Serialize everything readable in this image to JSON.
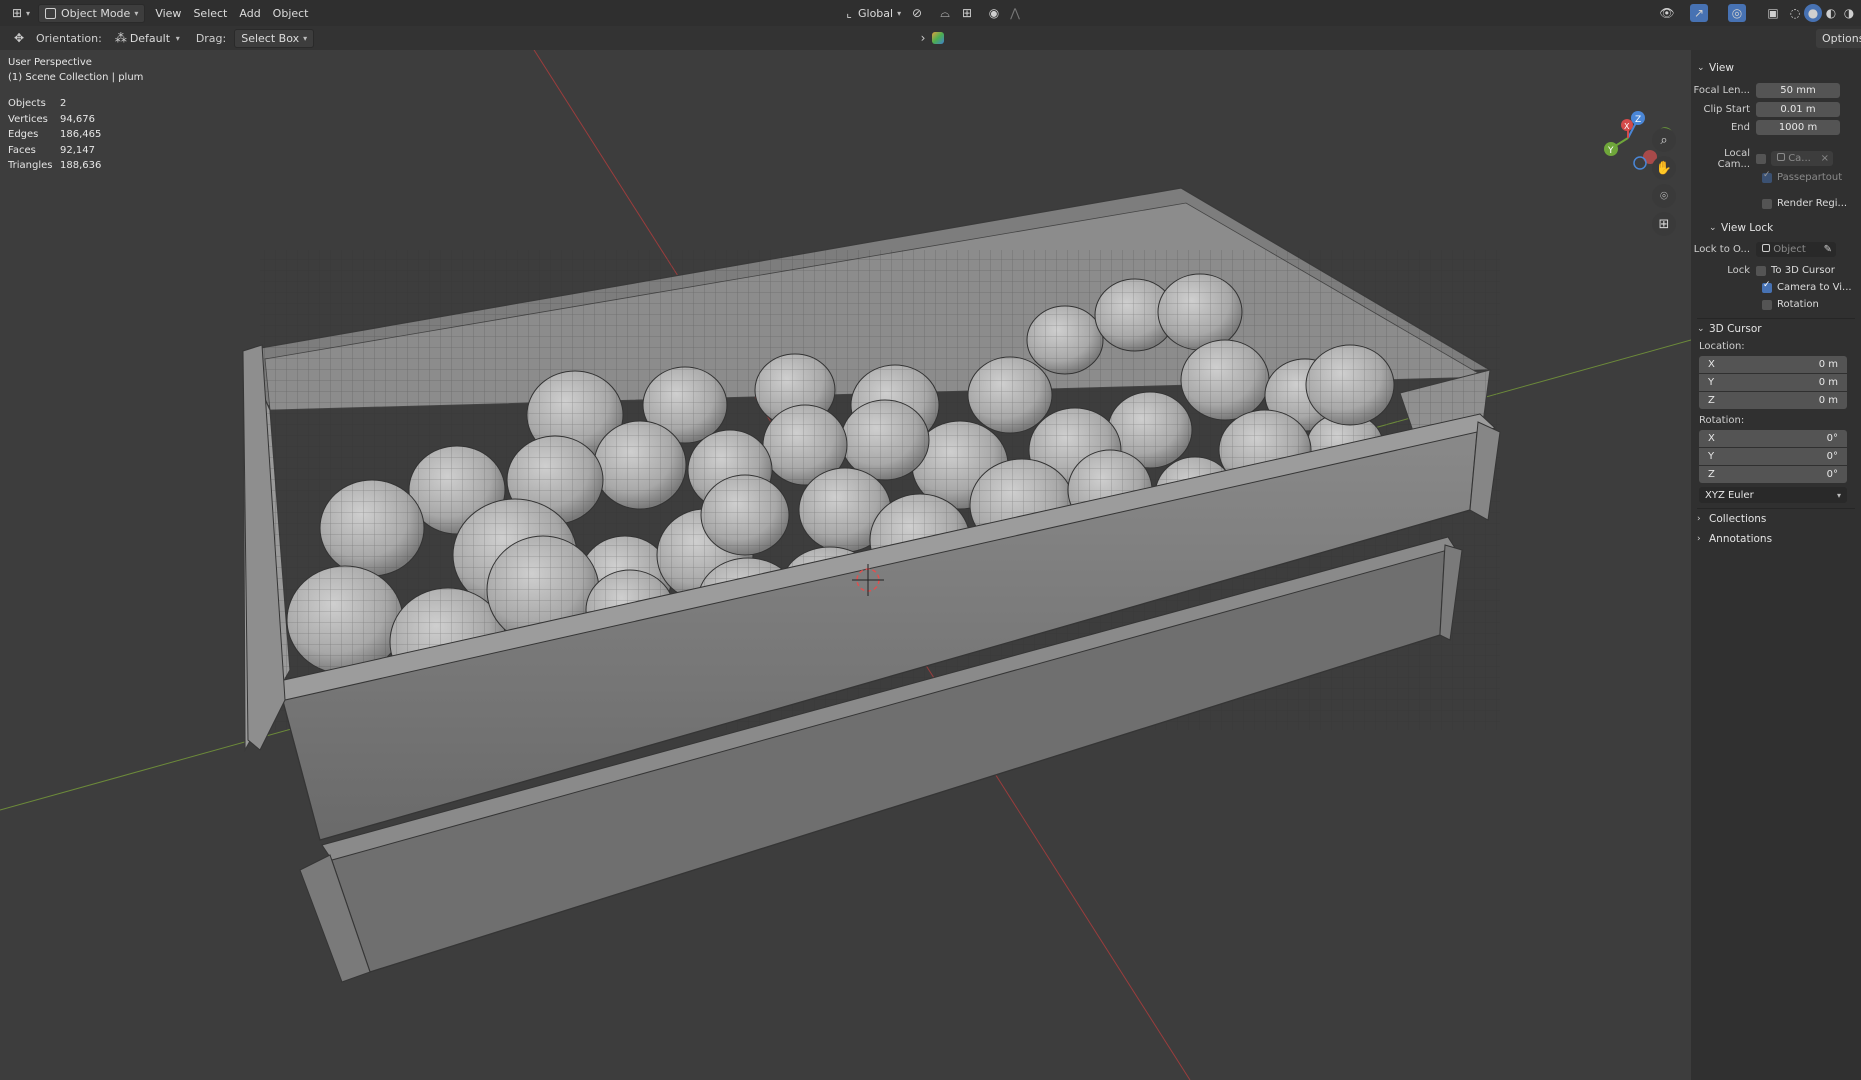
{
  "header": {
    "mode": "Object Mode",
    "menus": [
      "View",
      "Select",
      "Add",
      "Object"
    ],
    "transform_orientation": "Global"
  },
  "toolbar": {
    "orientation_label": "Orientation:",
    "orientation_value": "Default",
    "drag_label": "Drag:",
    "drag_value": "Select Box",
    "options_label": "Options"
  },
  "viewport": {
    "perspective": "User Perspective",
    "collection": "(1) Scene Collection | plum",
    "stats": [
      {
        "label": "Objects",
        "value": "2"
      },
      {
        "label": "Vertices",
        "value": "94,676"
      },
      {
        "label": "Edges",
        "value": "186,465"
      },
      {
        "label": "Faces",
        "value": "92,147"
      },
      {
        "label": "Triangles",
        "value": "188,636"
      }
    ],
    "gizmo": {
      "x": "X",
      "y": "Y",
      "z": "Z"
    }
  },
  "sidebar": {
    "view": {
      "title": "View",
      "focal_length_label": "Focal Len...",
      "focal_length": "50 mm",
      "clip_start_label": "Clip Start",
      "clip_start": "0.01 m",
      "clip_end_label": "End",
      "clip_end": "1000 m",
      "local_camera_label": "Local Cam...",
      "local_camera_value": "Ca...",
      "passepartout": "Passepartout",
      "render_region": "Render Regi..."
    },
    "view_lock": {
      "title": "View Lock",
      "lock_to_object_label": "Lock to O...",
      "lock_to_object_placeholder": "Object",
      "lock_label": "Lock",
      "to_3d_cursor": "To 3D Cursor",
      "camera_to_view": "Camera to Vi...",
      "rotation": "Rotation"
    },
    "cursor": {
      "title": "3D Cursor",
      "location_label": "Location:",
      "location": [
        {
          "axis": "X",
          "value": "0 m"
        },
        {
          "axis": "Y",
          "value": "0 m"
        },
        {
          "axis": "Z",
          "value": "0 m"
        }
      ],
      "rotation_label": "Rotation:",
      "rotation": [
        {
          "axis": "X",
          "value": "0°"
        },
        {
          "axis": "Y",
          "value": "0°"
        },
        {
          "axis": "Z",
          "value": "0°"
        }
      ],
      "rotation_mode": "XYZ Euler"
    },
    "collections": "Collections",
    "annotations": "Annotations"
  }
}
